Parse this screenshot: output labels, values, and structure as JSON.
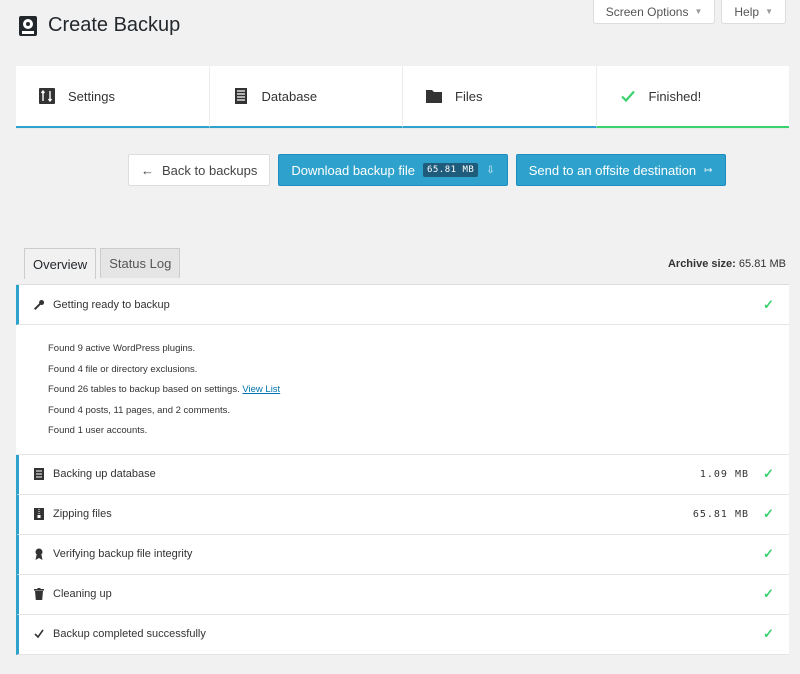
{
  "top_buttons": {
    "screen_options": "Screen Options",
    "help": "Help"
  },
  "page_title": "Create Backup",
  "steps": [
    {
      "label": "Settings",
      "icon": "settings-icon"
    },
    {
      "label": "Database",
      "icon": "database-icon"
    },
    {
      "label": "Files",
      "icon": "folder-icon"
    },
    {
      "label": "Finished!",
      "icon": "check-icon"
    }
  ],
  "actions": {
    "back": "Back to backups",
    "download": "Download backup file",
    "download_size": "65.81 MB",
    "send": "Send to an offsite destination"
  },
  "tabs": {
    "overview": "Overview",
    "status_log": "Status Log"
  },
  "archive": {
    "label": "Archive size:",
    "value": "65.81 MB"
  },
  "rows": {
    "ready": "Getting ready to backup",
    "database": "Backing up database",
    "database_size": "1.09 MB",
    "zipping": "Zipping files",
    "zipping_size": "65.81 MB",
    "verify": "Verifying backup file integrity",
    "cleanup": "Cleaning up",
    "complete": "Backup completed successfully"
  },
  "details": {
    "line1": "Found 9 active WordPress plugins.",
    "line2": "Found 4 file or directory exclusions.",
    "line3": "Found 26 tables to backup based on settings.",
    "line3_link": "View List",
    "line4": "Found 4 posts, 11 pages, and 2 comments.",
    "line5": "Found 1 user accounts."
  },
  "colors": {
    "accent": "#2ea2cc",
    "success": "#3ad26f"
  }
}
